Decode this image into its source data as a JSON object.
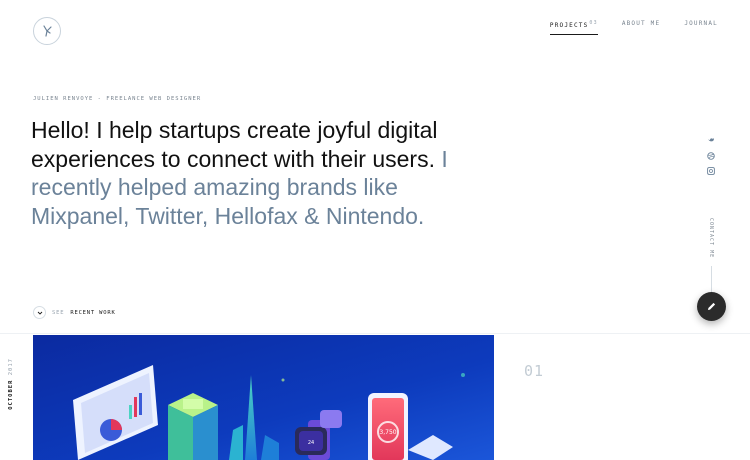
{
  "nav": {
    "items": [
      {
        "label": "PROJECTS",
        "count": "03"
      },
      {
        "label": "ABOUT ME"
      },
      {
        "label": "JOURNAL"
      }
    ]
  },
  "hero": {
    "kicker": "JULIEN RENVOYE - FREELANCE WEB DESIGNER",
    "headline_main": "Hello! I help startups create joyful digital experiences to connect with their users.",
    "headline_muted": "I recently helped amazing brands like Mixpanel, Twitter, Hellofax & Nintendo."
  },
  "cta": {
    "see": "SEE",
    "recent_work": "RECENT WORK"
  },
  "contact": {
    "label": "CONTACT ME"
  },
  "project": {
    "month": "OCTOBER",
    "year": "2017",
    "number": "01",
    "stats": {
      "badge_value": "24",
      "phone_value": "3,750"
    }
  },
  "icons": [
    "logo-bird-icon",
    "twitter-icon",
    "dribbble-icon",
    "instagram-icon",
    "chevron-down-icon",
    "pencil-icon"
  ],
  "colors": {
    "accent_muted": "#6b8299",
    "fab": "#2b2b2b",
    "hero_bg": "#0a2f9e"
  }
}
